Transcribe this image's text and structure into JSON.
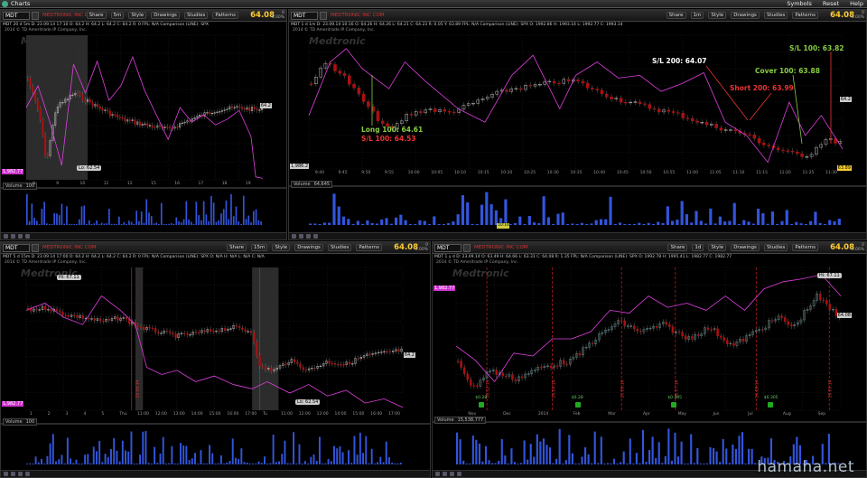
{
  "window": {
    "title": "Charts",
    "right_items": [
      "Symbols",
      "Reset",
      "Help"
    ]
  },
  "brand_watermark": "hamaha.net",
  "panels": [
    {
      "symbol": "MDT",
      "company": "MEDTRONIC INC COM",
      "price": "64.08",
      "change_line1": "0",
      "change_line2": "0.00%",
      "buttons": [
        "Share",
        "5m",
        "Style",
        "Drawings",
        "Studies",
        "Patterns"
      ],
      "info": "MDT 20 d 5m  D: 23.09.14 17:10  O: 64.2  H: 64.2  L: 64.2  C: 64.2  R: 0  FPL: N/A  Comparison (LINE): SPX",
      "copyright": "2014 © TD Ameritrade IP Company, Inc.",
      "watermark": "Medtronic",
      "low_label": "Lo: 62.54",
      "left_box": "1,982.77",
      "right_box": "64.2",
      "volume_label": "Volume",
      "volume_value": "100",
      "x_ticks": [
        "8",
        "9",
        "10",
        "11",
        "12",
        "15",
        "16",
        "17",
        "18",
        "19"
      ]
    },
    {
      "symbol": "MDT",
      "company": "MEDTRONIC INC COM",
      "price": "64.08",
      "change_line1": "0",
      "change_line2": "0.00%",
      "buttons": [
        "Share",
        "1m",
        "Style",
        "Drawings",
        "Studies",
        "Patterns"
      ],
      "info": "MDT 1 d 1m  D: 23.09.14 10:16  O: 64.26  H: 64.26  L: 64.21  C: 64.23  R: 0.05  Y: 63.89  FPL: N/A  Comparison (LINE): SPX  O: 1992.86  H: 1993.14  L: 1992.77  C: 1993.14",
      "copyright": "2014 © TD Ameritrade IP Company, Inc.",
      "watermark": "Medtronic",
      "left_box": "1,986.2",
      "right_box_top": "64.2",
      "right_box_bottom": "63.89",
      "volume_label": "Volume",
      "volume_value": "64,645",
      "time_marker": "10:16",
      "annotations": {
        "long": "Long 100: 64.61",
        "sl1": "S/L 100: 64.53",
        "sl200": "S/L 200: 64.07",
        "short200": "Short 200: 63.99",
        "cover100": "Cover 100: 63.88",
        "sl100b": "S/L 100: 63.82"
      },
      "x_ticks": [
        "9:40",
        "9:45",
        "9:50",
        "9:55",
        "10:00",
        "10:05",
        "10:10",
        "10:15",
        "10:20",
        "10:25",
        "10:30",
        "10:35",
        "10:40",
        "10:45",
        "10:50",
        "10:55",
        "11:00",
        "11:05",
        "11:10",
        "11:15",
        "11:20",
        "11:25",
        "11:30"
      ]
    },
    {
      "symbol": "MDT",
      "company": "MEDTRONIC INC COM",
      "price": "64.08",
      "change_line1": "0",
      "change_line2": "0.00%",
      "buttons": [
        "Share",
        "15m",
        "Style",
        "Drawings",
        "Studies",
        "Patterns"
      ],
      "info": "MDT 5 d 15m  D: 23.09.14 17:00  O: 64.2  H: 64.2  L: 64.2  C: 64.2  R: 0  FPL: N/A  Comparison (LINE): SPX  O: N/A  H: N/A  L: N/A  C: N/A",
      "copyright": "2014 © TD Ameritrade IP Company, Inc.",
      "watermark": "Medtronic",
      "hi_label": "Hi: 67.11",
      "low_label": "Lo: 62.54",
      "left_box": "1,982.77",
      "right_box": "64.2",
      "date_label": "19.09.14",
      "volume_label": "Volume",
      "volume_value": "100",
      "x_ticks": [
        "1",
        "2",
        "3",
        "4",
        "5",
        "Thu",
        "11:00",
        "12:00",
        "13:00",
        "14:00",
        "15:00",
        "16:00",
        "17:00",
        "Tu",
        "11:00",
        "12:00",
        "13:00",
        "14:00",
        "15:00",
        "16:00",
        "17:00"
      ]
    },
    {
      "symbol": "MDT",
      "company": "MEDTRONIC INC COM",
      "price": "64.08",
      "change_line1": "0",
      "change_line2": "0.00%",
      "buttons": [
        "Share",
        "1d",
        "Style",
        "Drawings",
        "Studies",
        "Patterns"
      ],
      "info": "MDT 1 y d  D: 23.09.14  O: 63.49  H: 64.66  L: 63.31  C: 64.08  R: 1.35  FPL: N/A  Comparison (LINE): SPX  O: 1992.78  H: 1995.41  L: 1982.77  C: 1982.77",
      "copyright": "2014 © TD Ameritrade IP Company, Inc.",
      "watermark": "Medtronic",
      "hi_label": "Hi: 67.11",
      "left_box": "1,982.77",
      "right_box": "64.08",
      "volume_label": "Volume",
      "volume_value": "15,538,777",
      "date_markers": [
        "19.12.13",
        "16.06.14",
        "20.06.14",
        "16.07.14",
        "16.08.14",
        "19.09.14"
      ],
      "dividends": [
        "$0.28",
        "$0.28",
        "$0.305",
        "$0.305"
      ],
      "x_ticks": [
        "Nov",
        "Dec",
        "2014",
        "Feb",
        "Mar",
        "Apr",
        "May",
        "Jun",
        "Jul",
        "Aug",
        "Sep"
      ]
    }
  ]
}
